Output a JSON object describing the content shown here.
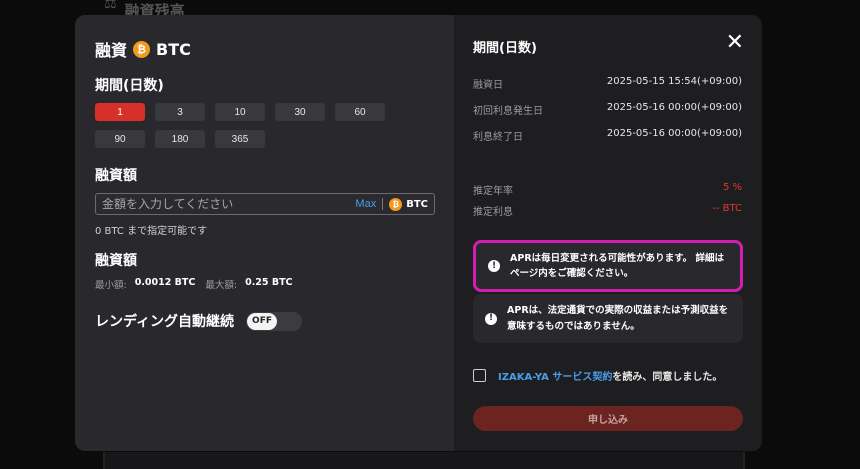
{
  "background": {
    "page_title": "融資残高"
  },
  "left": {
    "title": "融資",
    "currency": "BTC",
    "period_label": "期間(日数)",
    "period_options": [
      "1",
      "3",
      "10",
      "30",
      "60",
      "90",
      "180",
      "365"
    ],
    "selected_period": "1",
    "amount_label": "融資額",
    "amount_placeholder": "金額を入力してください",
    "max_label": "Max",
    "unit": "BTC",
    "available_text": "0 BTC まで指定可能です",
    "limits_label": "融資額",
    "min_label": "最小額:",
    "min_value": "0.0012 BTC",
    "max_amount_label": "最大額:",
    "max_amount_value": "0.25 BTC",
    "auto_renew_label": "レンディング自動継続",
    "toggle_state": "OFF"
  },
  "right": {
    "title": "期間(日数)",
    "rows": [
      {
        "label": "融資日",
        "value": "2025-05-15 15:54(+09:00)"
      },
      {
        "label": "初回利息発生日",
        "value": "2025-05-16 00:00(+09:00)"
      },
      {
        "label": "利息終了日",
        "value": "2025-05-16 00:00(+09:00)"
      }
    ],
    "apr_label": "推定年率",
    "apr_value": "5 %",
    "interest_label": "推定利息",
    "interest_value": "-- BTC",
    "notice1": "APRは毎日変更される可能性があります。 詳細はページ内をご確認ください。",
    "notice2": "APRは、法定通貨での実際の収益または予測収益を意味するものではありません。",
    "agree_link": "IZAKA-YA サービス契約",
    "agree_text": "を読み、同意しました。",
    "submit_label": "申し込み"
  },
  "colors": {
    "accent_red": "#d63128",
    "link_blue": "#4a9de8",
    "highlight": "#d21fb2",
    "bitcoin": "#f29a1d"
  }
}
